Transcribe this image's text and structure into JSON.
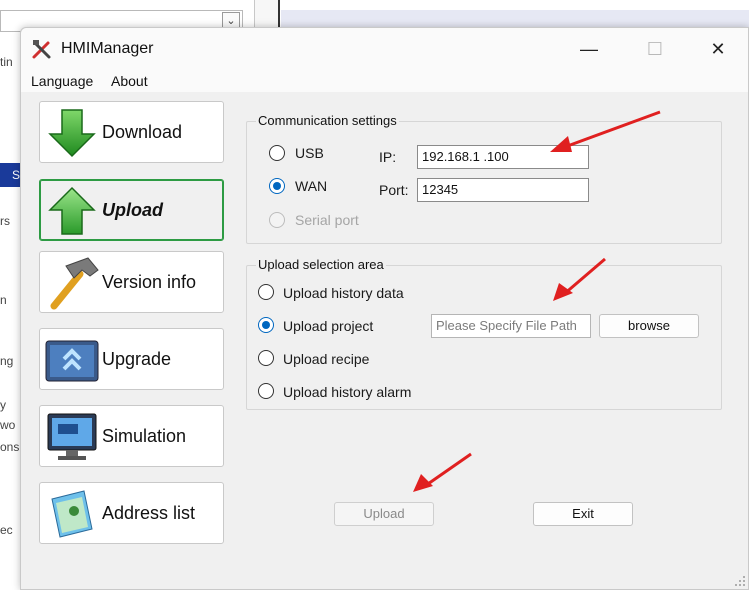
{
  "background": {
    "fragments": [
      "tin",
      "S",
      "rs",
      "n",
      "ng",
      "y",
      "wo",
      "ons",
      "ec"
    ]
  },
  "window": {
    "title": "HMIManager",
    "controls": {
      "minimize": "—",
      "maximize": "☐",
      "close": "✕"
    }
  },
  "menu": {
    "items": [
      "Language",
      "About"
    ]
  },
  "sidebar": {
    "items": [
      {
        "label": "Download",
        "icon": "download-arrow-icon"
      },
      {
        "label": "Upload",
        "icon": "upload-arrow-icon",
        "active": true
      },
      {
        "label": "Version info",
        "icon": "hammer-icon"
      },
      {
        "label": "Upgrade",
        "icon": "upgrade-chevrons-icon"
      },
      {
        "label": "Simulation",
        "icon": "monitor-icon"
      },
      {
        "label": "Address list",
        "icon": "address-book-icon"
      }
    ]
  },
  "communication": {
    "title": "Communication settings",
    "usb_label": "USB",
    "wan_label": "WAN",
    "serial_label": "Serial port",
    "selected": "WAN",
    "ip_label": "IP:",
    "ip_value": "192.168.1  .100",
    "port_label": "Port:",
    "port_value": "12345"
  },
  "upload_area": {
    "title": "Upload selection area",
    "options": [
      "Upload history data",
      "Upload project",
      "Upload recipe",
      "Upload history alarm"
    ],
    "selected": "Upload project",
    "file_placeholder": "Please Specify File Path",
    "browse_label": "browse"
  },
  "actions": {
    "upload_label": "Upload",
    "exit_label": "Exit"
  },
  "colors": {
    "accent": "#0067c0",
    "active_border": "#2d9b43",
    "annotation_arrow": "#e02020"
  }
}
